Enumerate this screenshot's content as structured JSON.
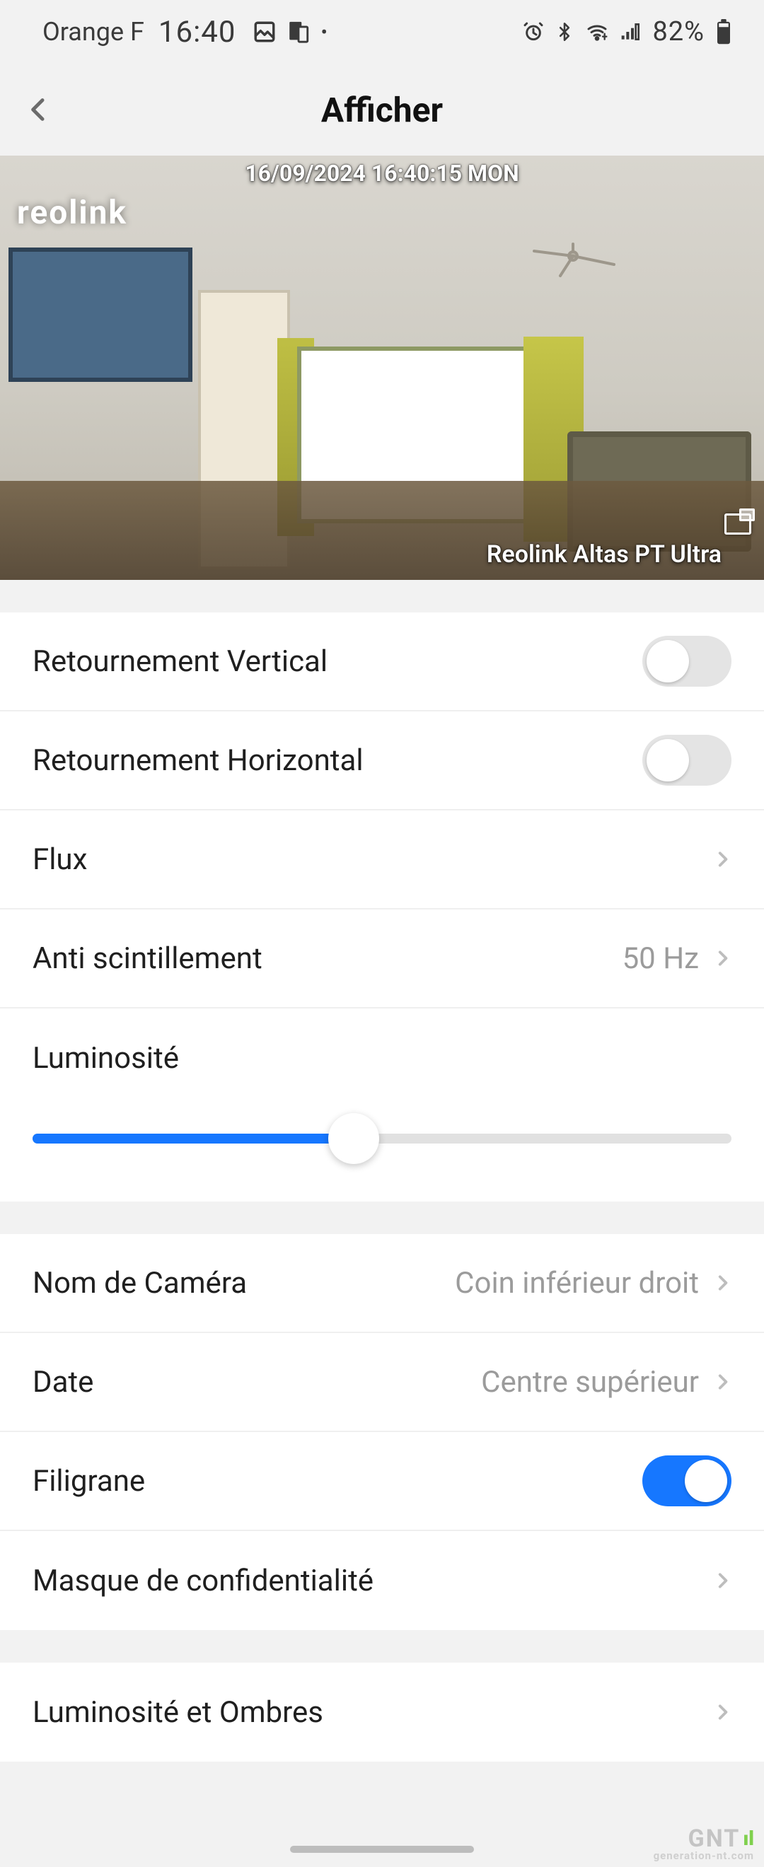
{
  "statusbar": {
    "carrier": "Orange F",
    "clock": "16:40",
    "battery": "82%"
  },
  "header": {
    "title": "Afficher"
  },
  "preview": {
    "brand": "reolink",
    "timestamp": "16/09/2024 16:40:15 MON",
    "camera_name_overlay": "Reolink Altas PT Ultra"
  },
  "settings": {
    "vertical_flip": {
      "label": "Retournement Vertical",
      "on": false
    },
    "horizontal_flip": {
      "label": "Retournement Horizontal",
      "on": false
    },
    "stream": {
      "label": "Flux"
    },
    "antiflicker": {
      "label": "Anti scintillement",
      "value": "50 Hz"
    },
    "brightness": {
      "label": "Luminosité",
      "percent": 46
    },
    "camera_name": {
      "label": "Nom de Caméra",
      "value": "Coin inférieur droit"
    },
    "date": {
      "label": "Date",
      "value": "Centre supérieur"
    },
    "watermark": {
      "label": "Filigrane",
      "on": true
    },
    "privacy_mask": {
      "label": "Masque de confidentialité"
    },
    "brightness_shadows": {
      "label": "Luminosité et Ombres"
    }
  },
  "footer": {
    "brand": "GNT",
    "sub": "generation-nt.com"
  }
}
